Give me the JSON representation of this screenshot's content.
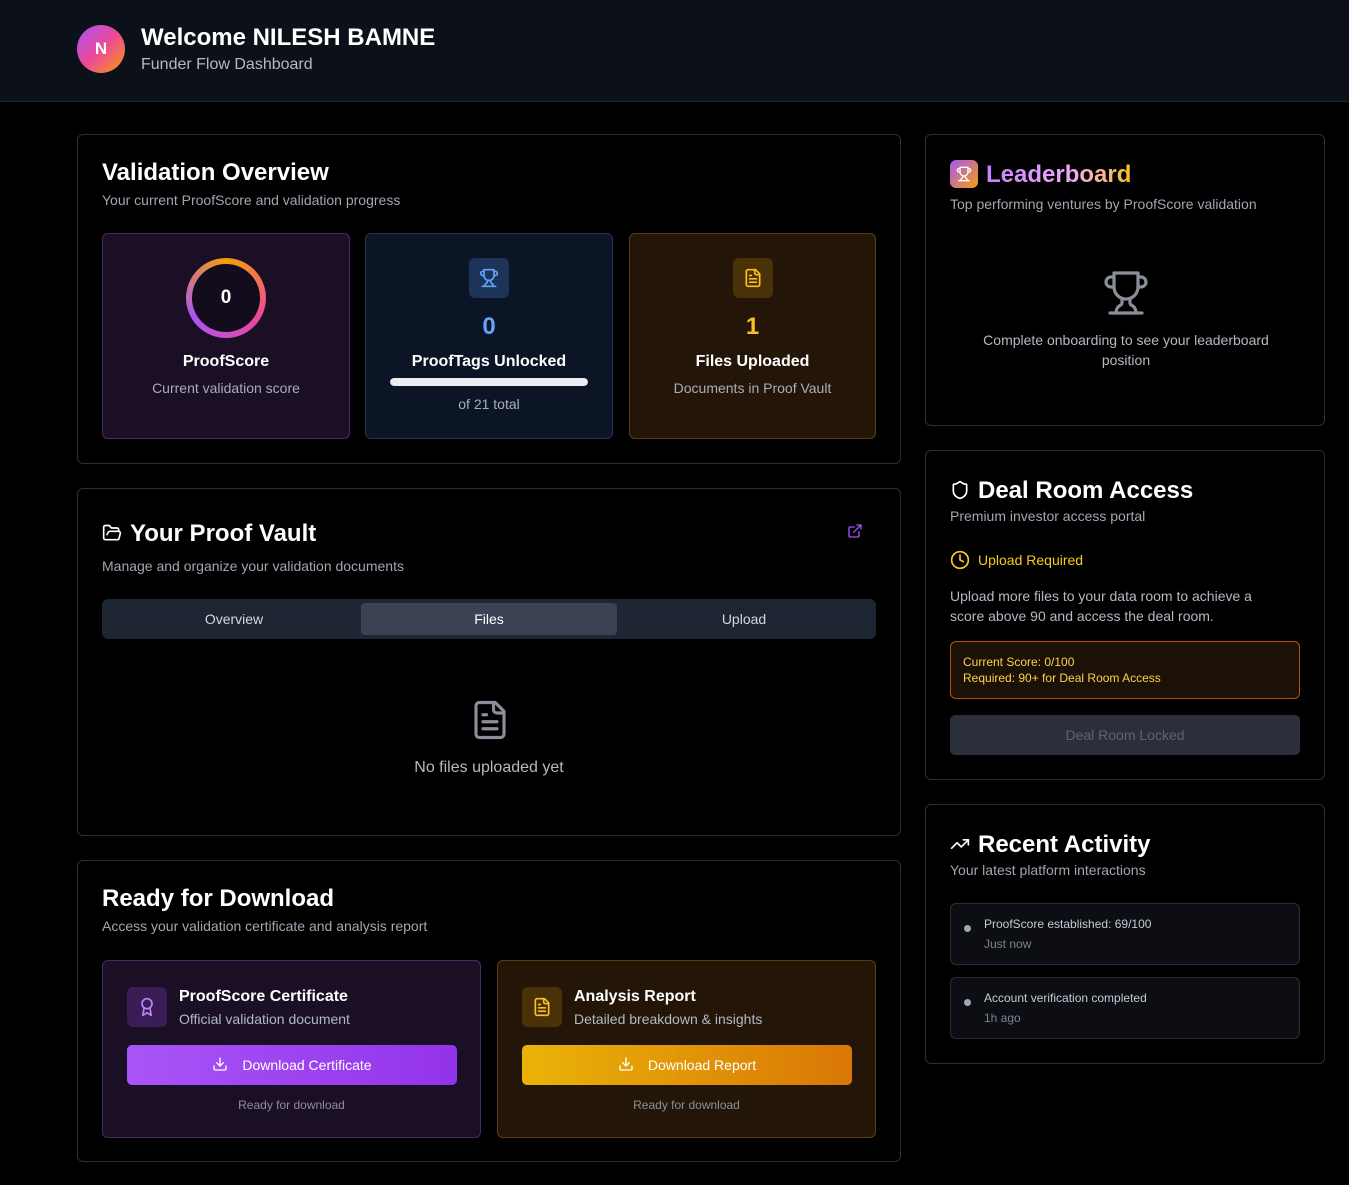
{
  "header": {
    "avatar_initial": "N",
    "welcome": "Welcome NILESH BAMNE",
    "subtitle": "Funder Flow Dashboard"
  },
  "validation": {
    "title": "Validation Overview",
    "subtitle": "Your current ProofScore and validation progress",
    "proofscore": {
      "value": "0",
      "label": "ProofScore",
      "desc": "Current validation score"
    },
    "prooftags": {
      "value": "0",
      "label": "ProofTags Unlocked",
      "desc": "of 21 total",
      "progress_fraction": 1.0
    },
    "files": {
      "value": "1",
      "label": "Files Uploaded",
      "desc": "Documents in Proof Vault"
    }
  },
  "vault": {
    "title": "Your Proof Vault",
    "subtitle": "Manage and organize your validation documents",
    "tabs": [
      {
        "label": "Overview",
        "active": false
      },
      {
        "label": "Files",
        "active": true
      },
      {
        "label": "Upload",
        "active": false
      }
    ],
    "empty_text": "No files uploaded yet"
  },
  "download": {
    "title": "Ready for Download",
    "subtitle": "Access your validation certificate and analysis report",
    "certificate": {
      "title": "ProofScore Certificate",
      "desc": "Official validation document",
      "button": "Download Certificate",
      "note": "Ready for download"
    },
    "report": {
      "title": "Analysis Report",
      "desc": "Detailed breakdown & insights",
      "button": "Download Report",
      "note": "Ready for download"
    }
  },
  "leaderboard": {
    "title": "Leaderboard",
    "subtitle": "Top performing ventures by ProofScore validation",
    "empty_text": "Complete onboarding to see your leaderboard position"
  },
  "dealroom": {
    "title": "Deal Room Access",
    "subtitle": "Premium investor access portal",
    "status": "Upload Required",
    "description": "Upload more files to your data room to achieve a score above 90 and access the deal room.",
    "current_score": "Current Score: 0/100",
    "required": "Required: 90+ for Deal Room Access",
    "button": "Deal Room Locked"
  },
  "activity": {
    "title": "Recent Activity",
    "subtitle": "Your latest platform interactions",
    "items": [
      {
        "text": "ProofScore established: 69/100",
        "time": "Just now"
      },
      {
        "text": "Account verification completed",
        "time": "1h ago"
      }
    ]
  },
  "colors": {
    "accent_purple": "#a855f7",
    "accent_amber": "#f59e0b",
    "accent_blue": "#60a5fa",
    "warning_yellow": "#facc15"
  }
}
